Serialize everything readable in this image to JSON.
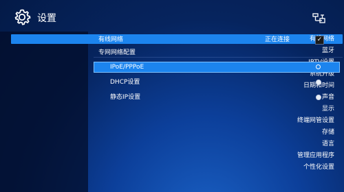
{
  "header": {
    "title": "设置",
    "settings_icon": "gear-icon",
    "network_icon": "network-icon"
  },
  "sidebar": {
    "items": [
      {
        "label": "有线网络",
        "active": true
      },
      {
        "label": "蓝牙"
      },
      {
        "label": "IPTV设置"
      },
      {
        "label": "系统升级"
      },
      {
        "label": "日期和时间"
      },
      {
        "label": "声音"
      },
      {
        "label": "显示"
      },
      {
        "label": "终端网管设置"
      },
      {
        "label": "存储"
      },
      {
        "label": "语言"
      },
      {
        "label": "管理应用程序"
      },
      {
        "label": "个性化设置"
      }
    ]
  },
  "main": {
    "wired_label": "有线网络",
    "wired_status": "正在连接",
    "wired_enabled": true,
    "checkbox_mark": "✓",
    "section_label": "专网网络配置",
    "options": [
      {
        "label": "IPoE/PPPoE",
        "selected": true
      },
      {
        "label": "DHCP设置",
        "selected": false
      },
      {
        "label": "静态IP设置",
        "selected": false
      }
    ]
  },
  "colors": {
    "accent": "#1c84ee",
    "background": "#06245e"
  }
}
